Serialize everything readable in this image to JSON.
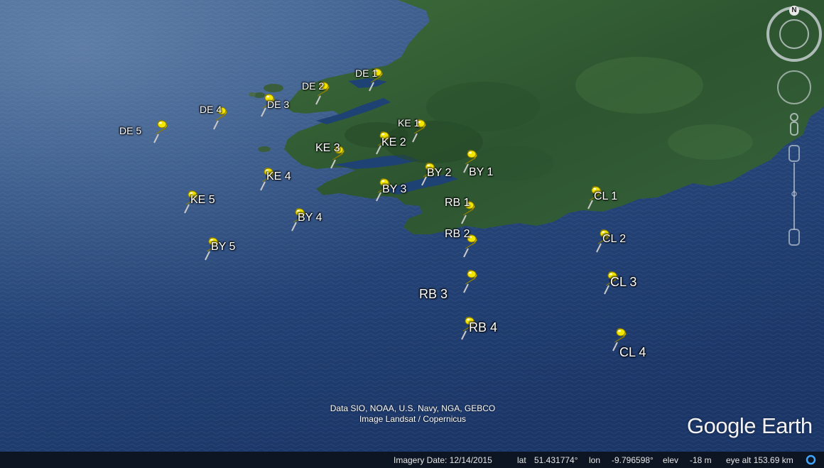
{
  "placemarks": [
    {
      "id": "DE 1",
      "pin": [
        520,
        116
      ],
      "lbl": [
        500,
        95
      ],
      "size": "s"
    },
    {
      "id": "DE 2",
      "pin": [
        445,
        135
      ],
      "lbl": [
        425,
        113
      ],
      "size": "s"
    },
    {
      "id": "DE 3",
      "pin": [
        368,
        152
      ],
      "lbl": [
        376,
        139
      ],
      "size": "s"
    },
    {
      "id": "DE 4",
      "pin": [
        301,
        170
      ],
      "lbl": [
        281,
        146
      ],
      "size": "s"
    },
    {
      "id": "DE 5",
      "pin": [
        217,
        189
      ],
      "lbl": [
        168,
        176
      ],
      "size": "s"
    },
    {
      "id": "KE 1",
      "pin": [
        581,
        188
      ],
      "lbl": [
        560,
        165
      ],
      "size": "s"
    },
    {
      "id": "KE 2",
      "pin": [
        530,
        205
      ],
      "lbl": [
        537,
        192
      ],
      "size": "m"
    },
    {
      "id": "KE 3",
      "pin": [
        466,
        225
      ],
      "lbl": [
        444,
        200
      ],
      "size": "m"
    },
    {
      "id": "KE 4",
      "pin": [
        367,
        256
      ],
      "lbl": [
        375,
        240
      ],
      "size": "m"
    },
    {
      "id": "KE 5",
      "pin": [
        260,
        288
      ],
      "lbl": [
        268,
        273
      ],
      "size": "m"
    },
    {
      "id": "BY 1",
      "pin": [
        653,
        231
      ],
      "lbl": [
        660,
        234
      ],
      "size": "m"
    },
    {
      "id": "BY 2",
      "pin": [
        594,
        249
      ],
      "lbl": [
        601,
        235
      ],
      "size": "m"
    },
    {
      "id": "BY 3",
      "pin": [
        530,
        271
      ],
      "lbl": [
        538,
        258
      ],
      "size": "m"
    },
    {
      "id": "BY 4",
      "pin": [
        411,
        313
      ],
      "lbl": [
        419,
        298
      ],
      "size": "m"
    },
    {
      "id": "BY 5",
      "pin": [
        289,
        354
      ],
      "lbl": [
        297,
        339
      ],
      "size": "m"
    },
    {
      "id": "RB 1",
      "pin": [
        650,
        303
      ],
      "lbl": [
        626,
        277
      ],
      "size": "m"
    },
    {
      "id": "RB 2",
      "pin": [
        653,
        350
      ],
      "lbl": [
        626,
        321
      ],
      "size": "m"
    },
    {
      "id": "RB 3",
      "pin": [
        653,
        400
      ],
      "lbl": [
        590,
        404
      ],
      "size": "l"
    },
    {
      "id": "RB 4",
      "pin": [
        650,
        466
      ],
      "lbl": [
        660,
        451
      ],
      "size": "l"
    },
    {
      "id": "CL 1",
      "pin": [
        828,
        282
      ],
      "lbl": [
        836,
        268
      ],
      "size": "m"
    },
    {
      "id": "CL 2",
      "pin": [
        840,
        343
      ],
      "lbl": [
        848,
        328
      ],
      "size": "m"
    },
    {
      "id": "CL 3",
      "pin": [
        851,
        402
      ],
      "lbl": [
        859,
        387
      ],
      "size": "l"
    },
    {
      "id": "CL 4",
      "pin": [
        863,
        482
      ],
      "lbl": [
        872,
        486
      ],
      "size": "l"
    }
  ],
  "attribution": {
    "line1": "Data SIO, NOAA, U.S. Navy, NGA, GEBCO",
    "line2": "Image Landsat / Copernicus"
  },
  "brand": "Google Earth",
  "compass_north": "N",
  "status": {
    "imagery_date": "Imagery Date: 12/14/2015",
    "lat_label": "lat",
    "lat_value": "51.431774°",
    "lon_label": "lon",
    "lon_value": "-9.796598°",
    "elev_label": "elev",
    "elev_value": "-18 m",
    "eye_alt": "eye alt 153.69 km"
  },
  "colors": {
    "ocean": "#1e3f73",
    "land": "#2f5a32",
    "pin": "#f3e600"
  }
}
